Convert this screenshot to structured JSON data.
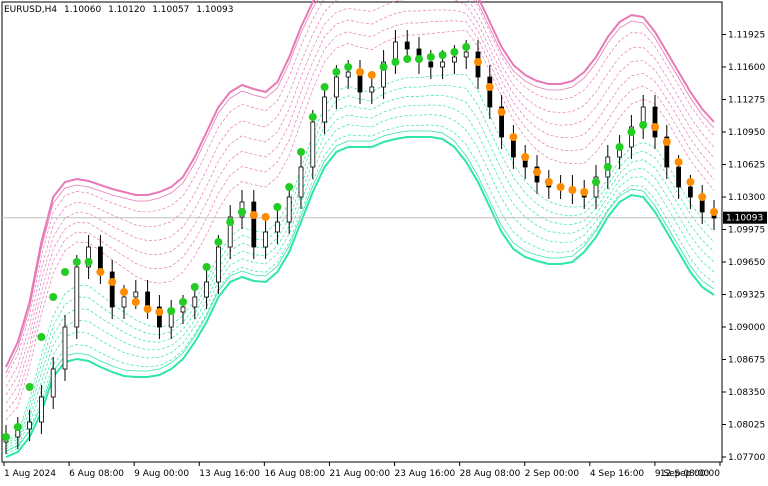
{
  "header": {
    "symbol": "EURUSD,H4",
    "open": "1.10060",
    "high": "1.10120",
    "low": "1.10057",
    "close": "1.10093"
  },
  "colors": {
    "background": "#ffffff",
    "axis": "#000000",
    "upper_band": "#e879b8",
    "lower_band": "#2ee6a6",
    "center_up": "#22cc22",
    "center_down": "#ff8c00",
    "candle": "#000000",
    "price_line": "#c0c0c0",
    "price_label_bg": "#000000",
    "price_label_fg": "#ffffff"
  },
  "chart_data": {
    "type": "line",
    "title": "EURUSD,H4",
    "ylim": [
      1.0765,
      1.1225
    ],
    "y_ticks": [
      "1.11925",
      "1.11600",
      "1.11275",
      "1.10950",
      "1.10625",
      "1.10300",
      "1.09975",
      "1.09650",
      "1.09325",
      "1.09000",
      "1.08675",
      "1.08350",
      "1.08025",
      "1.07700"
    ],
    "x_ticks": [
      "1 Aug 2024",
      "6 Aug 08:00",
      "9 Aug 00:00",
      "13 Aug 16:00",
      "16 Aug 08:00",
      "21 Aug 00:00",
      "23 Aug 16:00",
      "28 Aug 08:00",
      "2 Sep 00:00",
      "4 Sep 16:00",
      "9 Sep 08:00",
      "12 Sep 00:00"
    ],
    "current_price": "1.10093",
    "grid": false,
    "series": [
      {
        "role": "close",
        "values": [
          1.079,
          1.0798,
          1.0805,
          1.083,
          1.0858,
          1.09,
          1.096,
          1.098,
          1.0955,
          1.092,
          1.093,
          1.0935,
          1.092,
          1.09,
          1.0915,
          1.092,
          1.093,
          1.0945,
          1.098,
          1.101,
          1.1025,
          1.098,
          1.0995,
          1.1005,
          1.103,
          1.106,
          1.1105,
          1.113,
          1.115,
          1.1155,
          1.1135,
          1.114,
          1.1165,
          1.1185,
          1.1178,
          1.1165,
          1.116,
          1.1165,
          1.117,
          1.1175,
          1.115,
          1.112,
          1.109,
          1.107,
          1.106,
          1.1045,
          1.104,
          1.104,
          1.1035,
          1.103,
          1.105,
          1.107,
          1.108,
          1.11,
          1.112,
          1.109,
          1.106,
          1.104,
          1.103,
          1.1015,
          1.1009
        ]
      },
      {
        "role": "center",
        "values": [
          1.079,
          1.08,
          1.084,
          1.089,
          1.093,
          1.0955,
          1.0965,
          1.0965,
          1.0955,
          1.0945,
          1.0935,
          1.0925,
          1.0918,
          1.0915,
          1.0916,
          1.0925,
          1.094,
          1.096,
          1.0985,
          1.1005,
          1.1015,
          1.1012,
          1.101,
          1.102,
          1.104,
          1.1075,
          1.111,
          1.114,
          1.1155,
          1.116,
          1.1155,
          1.1152,
          1.116,
          1.1165,
          1.1168,
          1.1168,
          1.117,
          1.1172,
          1.1175,
          1.118,
          1.1165,
          1.114,
          1.1115,
          1.109,
          1.107,
          1.1055,
          1.1045,
          1.104,
          1.1037,
          1.1035,
          1.1045,
          1.106,
          1.108,
          1.1095,
          1.1102,
          1.11,
          1.1085,
          1.1065,
          1.1045,
          1.103,
          1.1015
        ]
      },
      {
        "role": "upper_band",
        "values": [
          1.086,
          1.0885,
          1.0925,
          1.0985,
          1.103,
          1.1045,
          1.1048,
          1.1046,
          1.1042,
          1.1038,
          1.1035,
          1.1032,
          1.1032,
          1.1035,
          1.104,
          1.105,
          1.107,
          1.1095,
          1.112,
          1.1135,
          1.1142,
          1.1138,
          1.1135,
          1.1145,
          1.117,
          1.12,
          1.1225,
          1.1245,
          1.1255,
          1.1258,
          1.1258,
          1.1258,
          1.1262,
          1.1266,
          1.1268,
          1.1268,
          1.1268,
          1.1266,
          1.1262,
          1.125,
          1.123,
          1.1205,
          1.118,
          1.1162,
          1.1152,
          1.1146,
          1.1143,
          1.1143,
          1.1146,
          1.1155,
          1.117,
          1.119,
          1.1205,
          1.1212,
          1.121,
          1.1195,
          1.1175,
          1.1155,
          1.1135,
          1.1118,
          1.1105
        ]
      },
      {
        "role": "lower_band",
        "values": [
          1.077,
          1.0775,
          1.079,
          1.0815,
          1.085,
          1.0865,
          1.0868,
          1.0866,
          1.086,
          1.0855,
          1.0851,
          1.085,
          1.085,
          1.0852,
          1.0858,
          1.0868,
          1.0885,
          1.0905,
          1.093,
          1.0945,
          1.095,
          1.0946,
          1.0945,
          1.0955,
          1.0975,
          1.1005,
          1.1035,
          1.106,
          1.1075,
          1.108,
          1.108,
          1.108,
          1.1085,
          1.1088,
          1.109,
          1.109,
          1.109,
          1.1088,
          1.108,
          1.1065,
          1.1045,
          1.102,
          1.0995,
          1.0978,
          1.097,
          1.0966,
          1.0963,
          1.0963,
          1.0965,
          1.0975,
          1.099,
          1.101,
          1.1025,
          1.1032,
          1.103,
          1.1015,
          1.0995,
          1.0975,
          1.0955,
          1.094,
          1.0932
        ]
      }
    ]
  }
}
